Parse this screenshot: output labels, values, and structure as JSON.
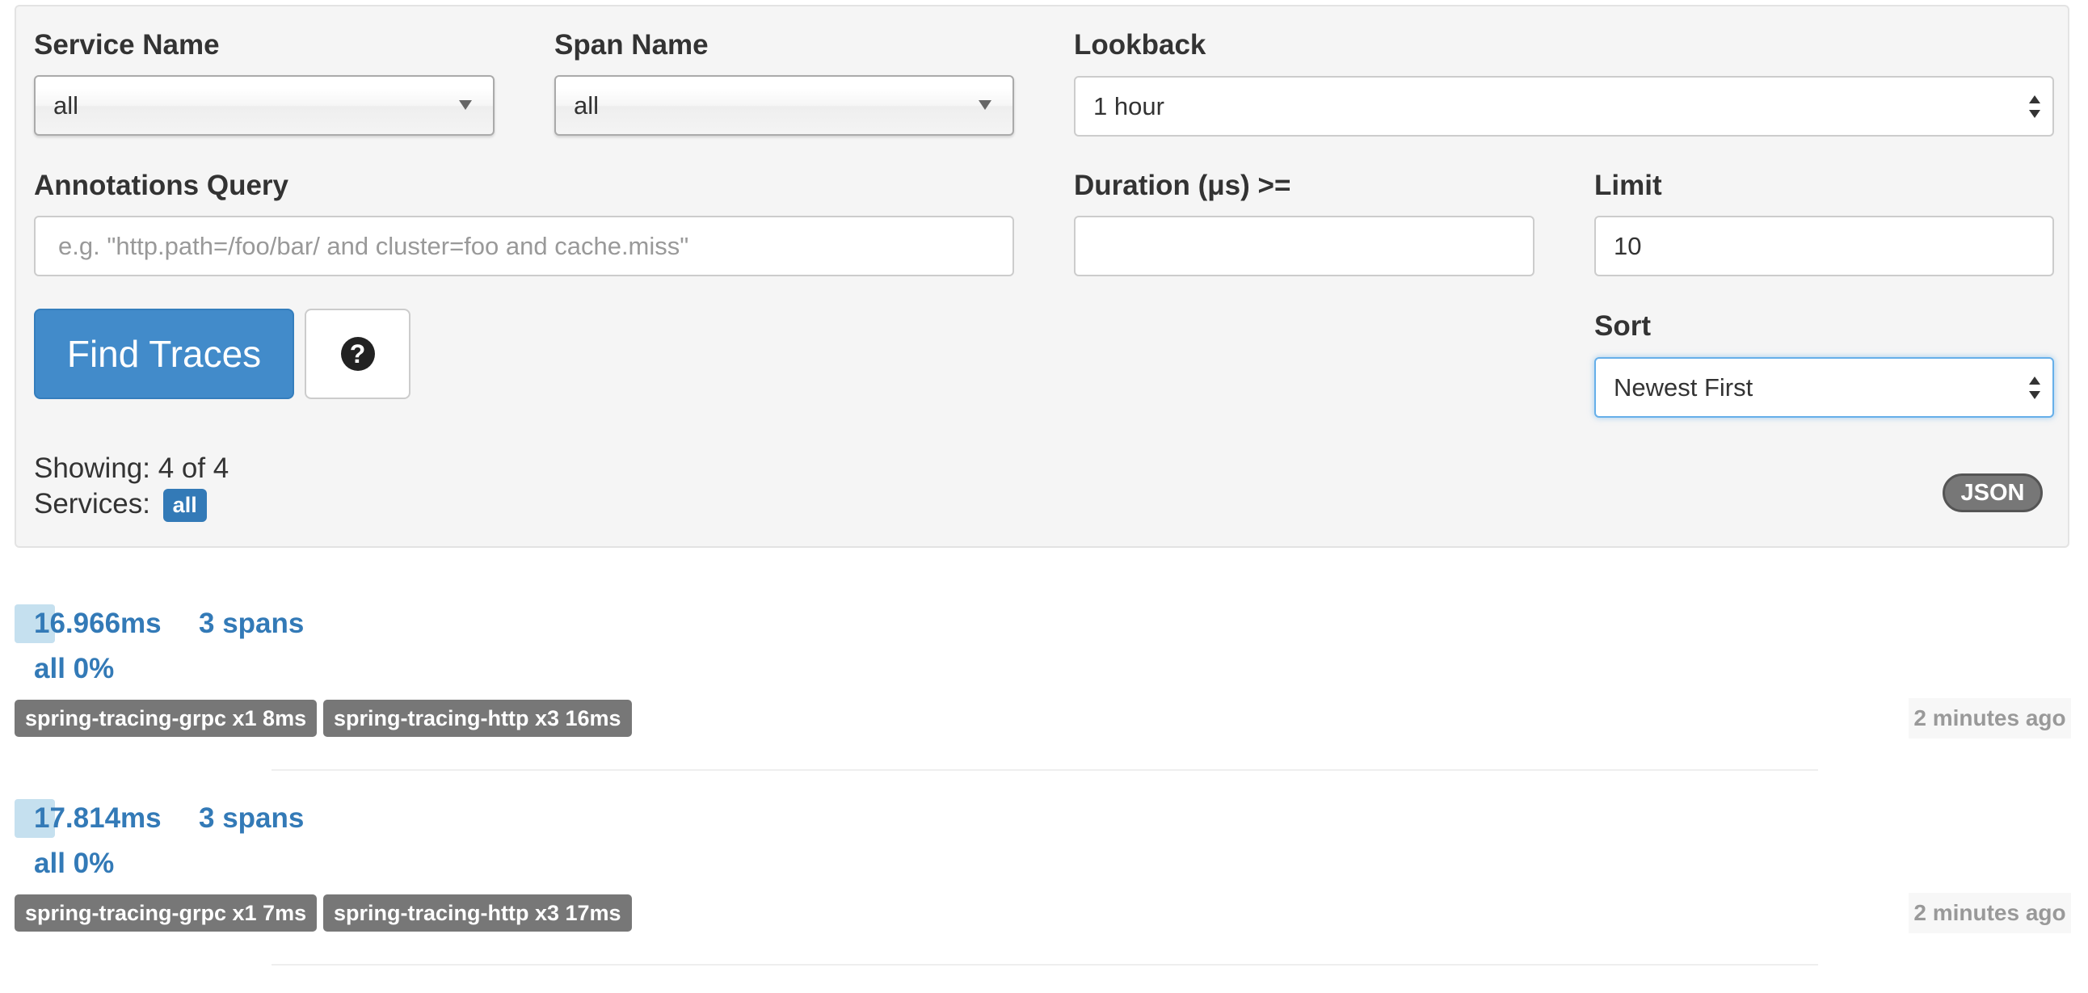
{
  "form": {
    "service_name": {
      "label": "Service Name",
      "value": "all"
    },
    "span_name": {
      "label": "Span Name",
      "value": "all"
    },
    "lookback": {
      "label": "Lookback",
      "value": "1 hour"
    },
    "annotations_query": {
      "label": "Annotations Query",
      "value": "",
      "placeholder": "e.g. \"http.path=/foo/bar/ and cluster=foo and cache.miss\""
    },
    "duration": {
      "label": "Duration (μs) >=",
      "value": ""
    },
    "limit": {
      "label": "Limit",
      "value": "10"
    },
    "sort": {
      "label": "Sort",
      "value": "Newest First"
    },
    "find_button": "Find Traces",
    "help_glyph": "?"
  },
  "summary": {
    "showing": "Showing: 4 of 4",
    "services_label": "Services:",
    "services_badge": "all",
    "json_button": "JSON"
  },
  "traces": [
    {
      "duration": "16.966ms",
      "spans": "3 spans",
      "service_pct": "all 0%",
      "tags": [
        "spring-tracing-grpc x1 8ms",
        "spring-tracing-http x3 16ms"
      ],
      "time_ago": "2 minutes ago"
    },
    {
      "duration": "17.814ms",
      "spans": "3 spans",
      "service_pct": "all 0%",
      "tags": [
        "spring-tracing-grpc x1 7ms",
        "spring-tracing-http x3 17ms"
      ],
      "time_ago": "2 minutes ago"
    }
  ],
  "colors": {
    "panel_bg": "#f5f5f5",
    "primary": "#428bca",
    "link": "#337ab7",
    "tag_bg": "#777777",
    "duration_bar": "#c5e0ef"
  }
}
